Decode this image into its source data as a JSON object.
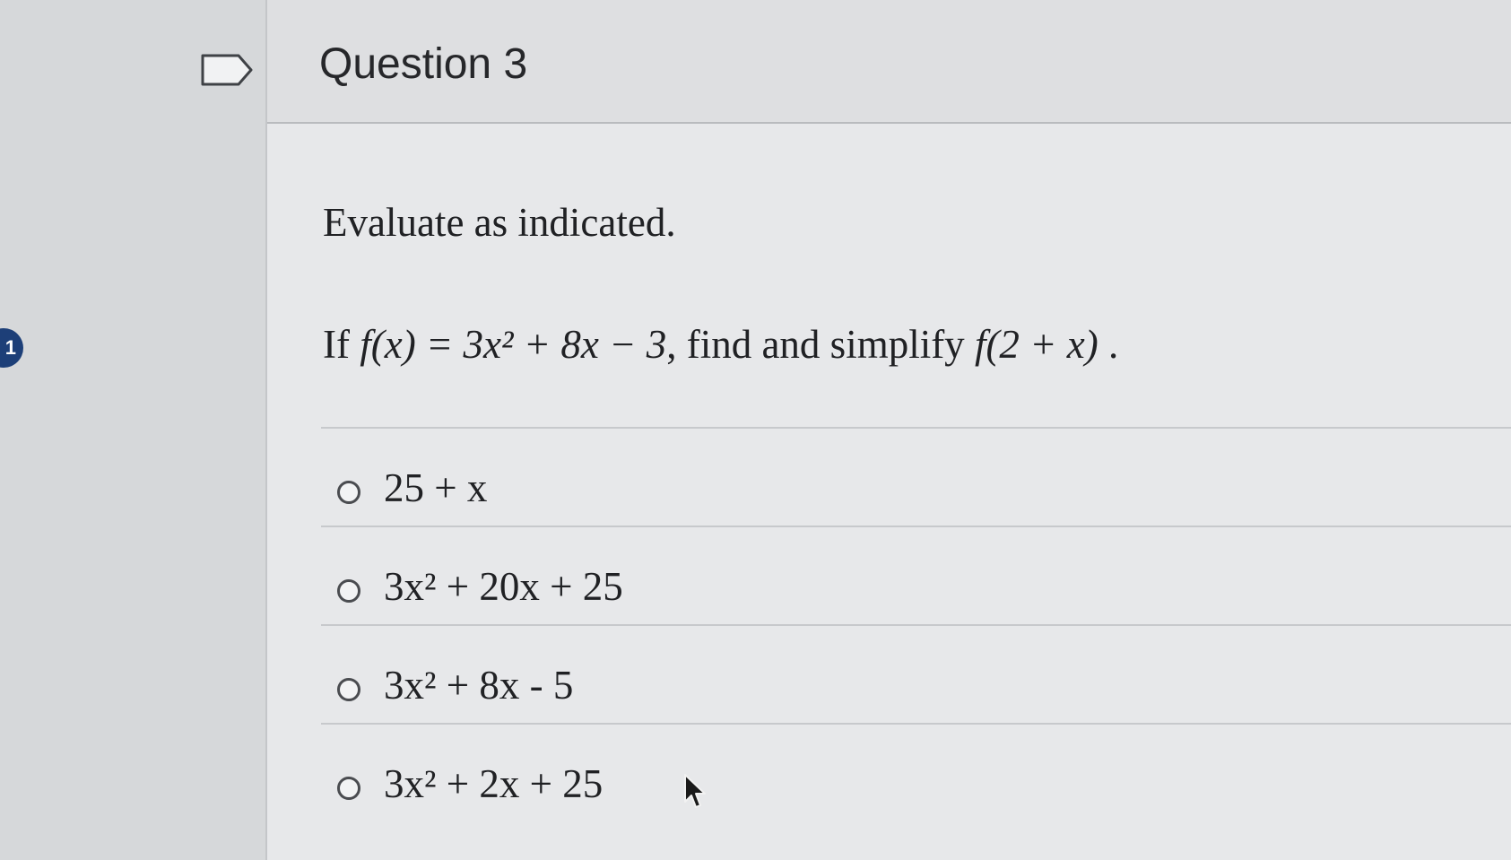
{
  "sidebar": {
    "badge_label": "1"
  },
  "question": {
    "title": "Question 3",
    "instruction": "Evaluate as indicated.",
    "prompt": {
      "lead": "If ",
      "function": "f(x) = 3x² + 8x − 3",
      "middle": ", find and simplify ",
      "target": "f(2 + x)",
      "end": " ."
    }
  },
  "options": [
    {
      "label": "25 + x"
    },
    {
      "label": "3x² + 20x + 25"
    },
    {
      "label": "3x² + 8x - 5"
    },
    {
      "label": "3x² + 2x + 25"
    }
  ],
  "icons": {
    "flag": "flag-icon",
    "cursor": "cursor-icon"
  },
  "colors": {
    "badge": "#1d3f78",
    "page_bg": "#dcdddf"
  }
}
